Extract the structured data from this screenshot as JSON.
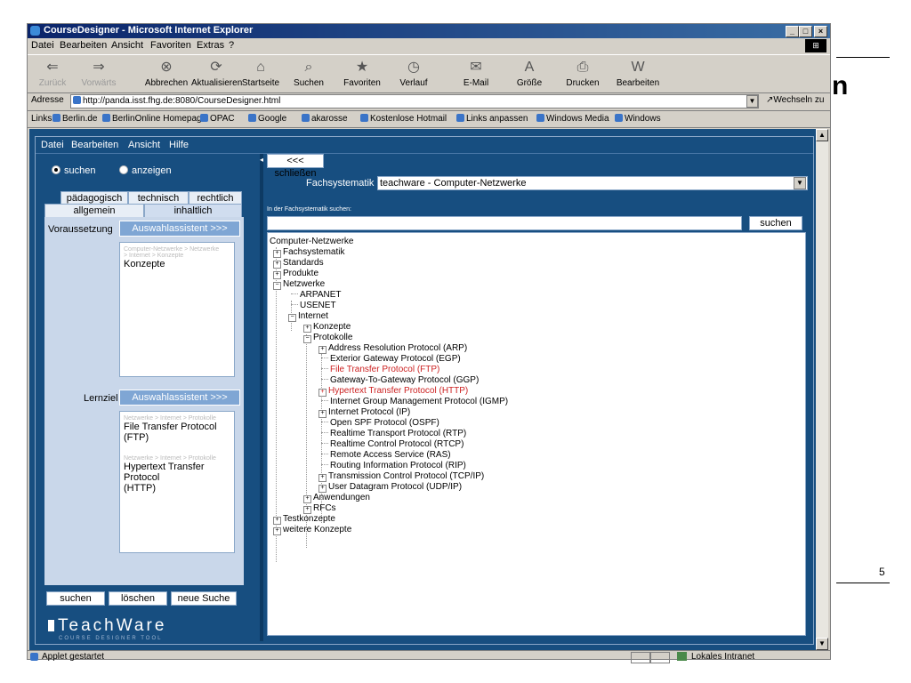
{
  "window": {
    "title": "CourseDesigner - Microsoft Internet Explorer"
  },
  "menu": [
    "Datei",
    "Bearbeiten",
    "Ansicht",
    "Favoriten",
    "Extras",
    "?"
  ],
  "toolbar": {
    "back": "Zurück",
    "forward": "Vorwärts",
    "stop": "Abbrechen",
    "refresh": "Aktualisieren",
    "home": "Startseite",
    "search": "Suchen",
    "favorites": "Favoriten",
    "history": "Verlauf",
    "mail": "E-Mail",
    "size": "Größe",
    "print": "Drucken",
    "edit": "Bearbeiten"
  },
  "address": {
    "label": "Adresse",
    "url": "http://panda.isst.fhg.de:8080/CourseDesigner.html",
    "go": "Wechseln zu"
  },
  "links": {
    "label": "Links",
    "items": [
      "Berlin.de",
      "BerlinOnline Homepage",
      "OPAC",
      "Google",
      "akarosse",
      "Kostenlose Hotmail",
      "Links anpassen",
      "Windows Media",
      "Windows"
    ]
  },
  "status": {
    "text": "Applet gestartet",
    "zone": "Lokales Intranet"
  },
  "applet": {
    "menu": [
      "Datei",
      "Bearbeiten",
      "Ansicht",
      "Hilfe"
    ],
    "mode": {
      "search": "suchen",
      "show": "anzeigen"
    },
    "tabs": {
      "paedagogisch": "pädagogisch",
      "technisch": "technisch",
      "rechtlich": "rechtlich",
      "allgemein": "allgemein",
      "inhaltlich": "inhaltlich"
    },
    "voraussetzung": {
      "label": "Voraussetzung",
      "button": "Auswahlassistent >>>",
      "crumb1": "Computer-Netzwerke > Netzwerke",
      "crumb2": "> Internet > Konzepte",
      "value": "Konzepte"
    },
    "lernziel": {
      "label": "Lernziel",
      "button": "Auswahlassistent >>>",
      "crumb1": "Netzwerke > Internet > Protokolle",
      "value1": "File Transfer Protocol (FTP)",
      "crumb2": "Netzwerke > Internet > Protokolle",
      "value2a": "Hypertext Transfer Protocol",
      "value2b": "(HTTP)"
    },
    "buttons": {
      "search": "suchen",
      "clear": "löschen",
      "new": "neue Suche"
    },
    "logo": {
      "name": "TeachWare",
      "sub": "COURSE DESIGNER TOOL"
    },
    "close": "<<< schließen",
    "fachsystematik": {
      "label": "Fachsystematik",
      "value": "teachware - Computer-Netzwerke"
    },
    "searchlabel": "In der Fachsystematik suchen:",
    "searchbutton": "suchen",
    "tree": [
      {
        "t": "Computer-Netzwerke"
      },
      {
        "t": "Fachsystematik"
      },
      {
        "t": "Standards"
      },
      {
        "t": "Produkte"
      },
      {
        "t": "Netzwerke"
      },
      {
        "t": "ARPANET"
      },
      {
        "t": "USENET"
      },
      {
        "t": "Internet"
      },
      {
        "t": "Konzepte"
      },
      {
        "t": "Protokolle"
      },
      {
        "t": "Address Resolution Protocol (ARP)"
      },
      {
        "t": "Exterior Gateway Protocol (EGP)"
      },
      {
        "t": "File Transfer Protocol (FTP)"
      },
      {
        "t": "Gateway-To-Gateway Protocol (GGP)"
      },
      {
        "t": "Hypertext Transfer Protocol (HTTP)"
      },
      {
        "t": "Internet Group Management Protocol (IGMP)"
      },
      {
        "t": "Internet Protocol (IP)"
      },
      {
        "t": "Open SPF Protocol (OSPF)"
      },
      {
        "t": "Realtime Transport Protocol (RTP)"
      },
      {
        "t": "Realtime Control Protocol (RTCP)"
      },
      {
        "t": "Remote Access Service (RAS)"
      },
      {
        "t": "Routing Information Protocol (RIP)"
      },
      {
        "t": "Transmission Control Protocol (TCP/IP)"
      },
      {
        "t": "User Datagram Protocol (UDP/IP)"
      },
      {
        "t": "Anwendungen"
      },
      {
        "t": "RFCs"
      },
      {
        "t": "Testkonzepte"
      },
      {
        "t": "weitere Konzepte"
      }
    ]
  },
  "page": {
    "number": "5",
    "clipped": "n"
  }
}
